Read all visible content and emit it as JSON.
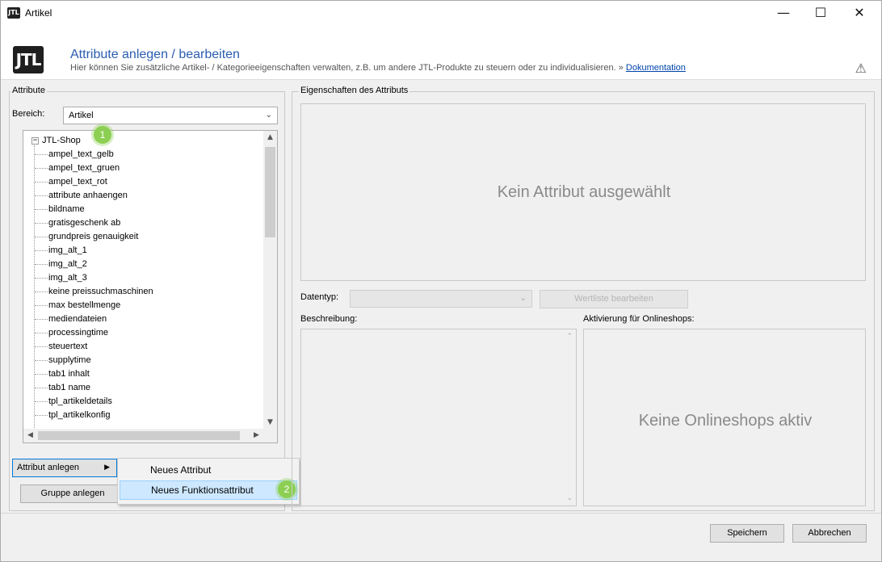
{
  "window": {
    "title": "Artikel",
    "icon_text": "JTL",
    "controls": {
      "minimize": "—",
      "maximize": "☐",
      "close": "✕"
    }
  },
  "header": {
    "logo": "JTL",
    "title": "Attribute anlegen / bearbeiten",
    "subtitle": "Hier können Sie zusätzliche Artikel- / Kategorieeigenschaften verwalten, z.B. um andere JTL-Produkte zu steuern oder zu individualisieren.",
    "subtitle_sep": "»",
    "doc_link": "Dokumentation",
    "warning_icon": "warning-icon"
  },
  "attributes_panel": {
    "legend": "Attribute",
    "bereich_label": "Bereich:",
    "bereich_value": "Artikel",
    "tree_root": "JTL-Shop",
    "tree_items": [
      "ampel_text_gelb",
      "ampel_text_gruen",
      "ampel_text_rot",
      "attribute anhaengen",
      "bildname",
      "gratisgeschenk ab",
      "grundpreis genauigkeit",
      "img_alt_1",
      "img_alt_2",
      "img_alt_3",
      "keine preissuchmaschinen",
      "max bestellmenge",
      "mediendateien",
      "processingtime",
      "steuertext",
      "supplytime",
      "tab1 inhalt",
      "tab1 name",
      "tpl_artikeldetails",
      "tpl_artikelkonfig"
    ],
    "attribut_anlegen_label": "Attribut anlegen",
    "gruppe_anlegen_label": "Gruppe anlegen"
  },
  "context_menu": {
    "items": [
      "Neues Attribut",
      "Neues Funktionsattribut"
    ]
  },
  "badges": {
    "one": "1",
    "two": "2"
  },
  "properties_panel": {
    "legend": "Eigenschaften des Attributs",
    "empty_text": "Kein Attribut ausgewählt",
    "datentyp_label": "Datentyp:",
    "datentyp_value": "",
    "wertliste_label": "Wertliste bearbeiten",
    "beschreibung_label": "Beschreibung:",
    "aktivierung_label": "Aktivierung für Onlineshops:",
    "onlineshops_empty": "Keine Onlineshops aktiv"
  },
  "footer": {
    "save_label": "Speichern",
    "cancel_label": "Abbrechen"
  },
  "colors": {
    "accent": "#2a5db0",
    "badge": "#8ccf52",
    "menu_highlight": "#cde8ff"
  }
}
